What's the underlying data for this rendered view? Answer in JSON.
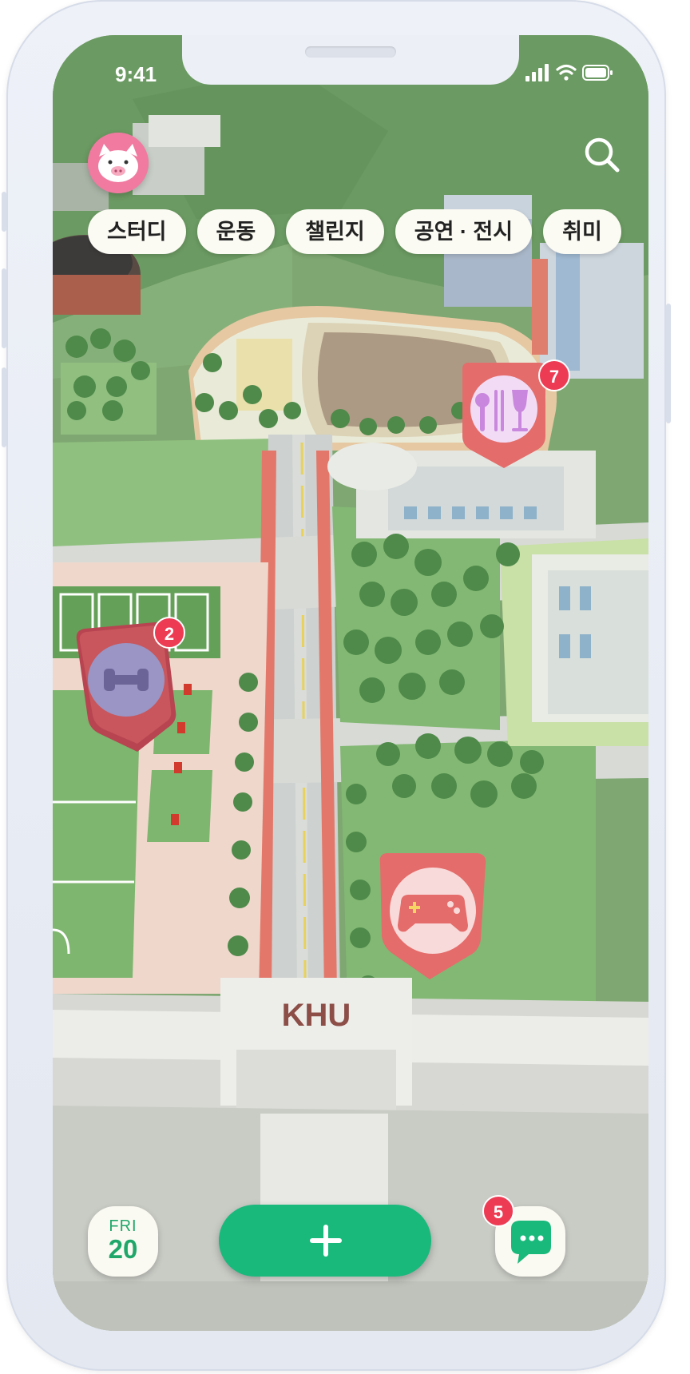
{
  "status_bar": {
    "time": "9:41"
  },
  "categories": [
    {
      "label": "스터디"
    },
    {
      "label": "운동"
    },
    {
      "label": "챌린지"
    },
    {
      "label": "공연 · 전시"
    },
    {
      "label": "취미"
    }
  ],
  "map": {
    "campus_sign": "KHU",
    "pins": [
      {
        "icon": "dining-icon",
        "count": "7",
        "color": "#e46c6a"
      },
      {
        "icon": "fitness-icon",
        "count": "2",
        "color": "#c8565c"
      },
      {
        "icon": "game-controller-icon",
        "count": "",
        "color": "#e46c6a"
      }
    ]
  },
  "bottom_bar": {
    "weekday": "FRI",
    "day": "20",
    "chat_badge": "5"
  },
  "colors": {
    "accent_green": "#19b97c",
    "badge_red": "#ee3b54",
    "avatar_pink": "#f07aa0"
  }
}
